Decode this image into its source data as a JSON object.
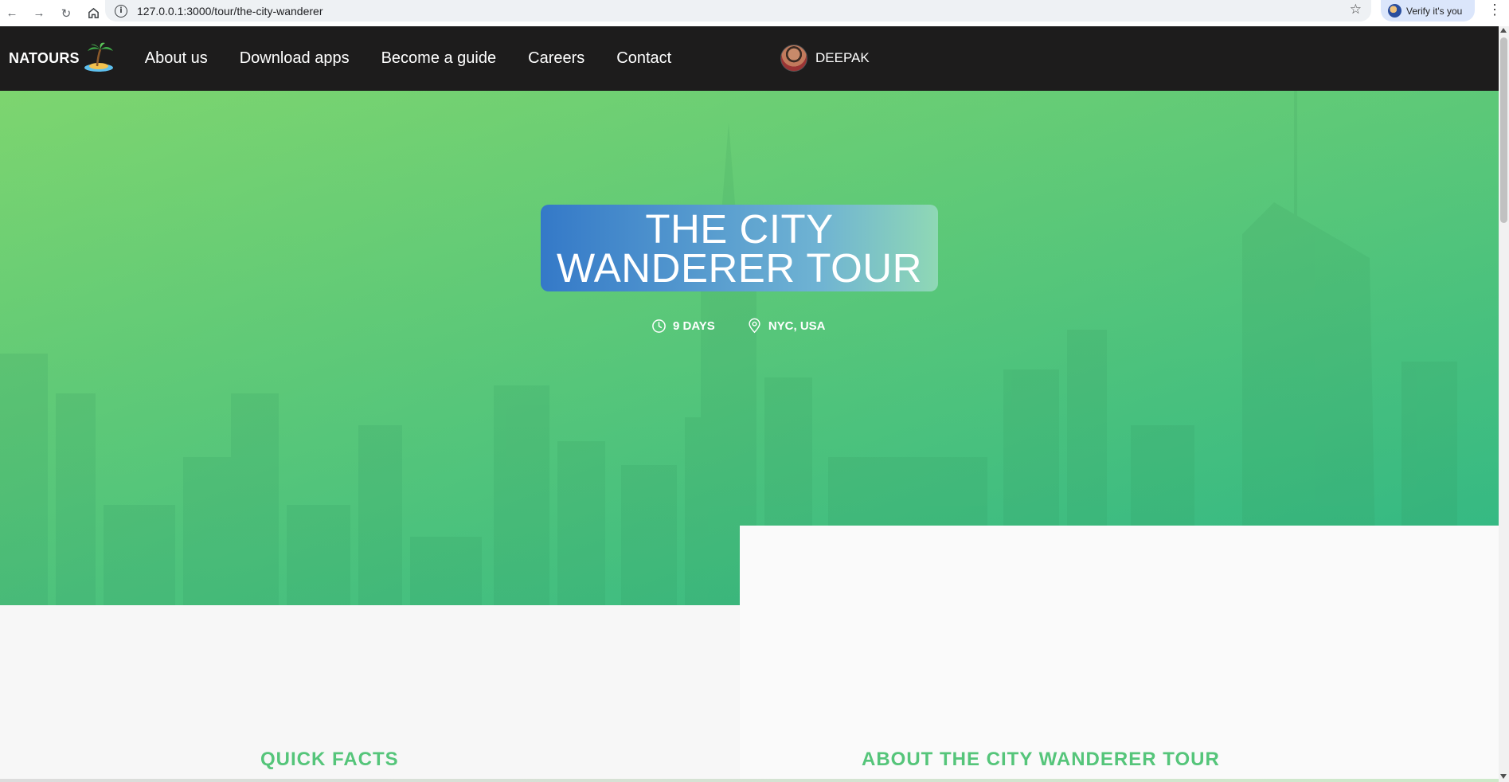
{
  "browser": {
    "back_icon": "arrow-left-icon",
    "forward_icon": "arrow-right-icon",
    "reload_icon": "reload-icon",
    "home_icon": "home-icon",
    "url": "127.0.0.1:3000/tour/the-city-wanderer",
    "verify_label": "Verify it's you"
  },
  "header": {
    "logo_text": "NATOURS",
    "nav": [
      "About us",
      "Download apps",
      "Become a guide",
      "Careers",
      "Contact"
    ],
    "user_name": "DEEPAK"
  },
  "hero": {
    "title_line1": "THE CITY",
    "title_line2": "WANDERER TOUR",
    "duration": "9 DAYS",
    "location": "NYC, USA"
  },
  "sections": {
    "quick_facts_heading": "QUICK FACTS",
    "about_heading": "ABOUT THE CITY WANDERER TOUR"
  },
  "colors": {
    "brand_green": "#55c57a",
    "header_bg": "#1d1c1c",
    "hero_gradient_start": "#7dd56f",
    "hero_gradient_end": "#28b487",
    "title_box_start": "#3479c8"
  }
}
